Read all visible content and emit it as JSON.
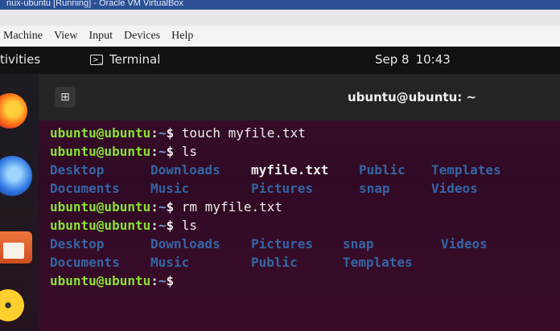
{
  "vbox": {
    "title": "nux-ubuntu [Running] - Oracle VM VirtualBox",
    "menu": [
      "Machine",
      "View",
      "Input",
      "Devices",
      "Help"
    ]
  },
  "topbar": {
    "activities": "tivities",
    "app_label": "Terminal",
    "date": "Sep 8",
    "time": "10:43"
  },
  "terminal": {
    "title": "ubuntu@ubuntu: ~",
    "new_tab_icon": "new-tab-icon",
    "prompt": {
      "user": "ubuntu@ubuntu",
      "colon": ":",
      "path": "~",
      "dollar": "$"
    },
    "commands": [
      "touch myfile.txt",
      "ls",
      "rm myfile.txt",
      "ls"
    ],
    "ls1": {
      "row1": [
        "Desktop",
        "Downloads",
        "myfile.txt",
        "Public",
        "Templates"
      ],
      "row2": [
        "Documents",
        "Music",
        "Pictures",
        "snap",
        "Videos"
      ]
    },
    "ls2": {
      "row1": [
        "Desktop",
        "Downloads",
        "Pictures",
        "snap",
        "Videos"
      ],
      "row2": [
        "Documents",
        "Music",
        "Public",
        "Templates"
      ]
    }
  },
  "dock": [
    "firefox-icon",
    "thunderbird-icon",
    "files-icon",
    "rhythmbox-icon"
  ],
  "colors": {
    "terminal_bg": "#300a24",
    "prompt_user": "#8ae234",
    "prompt_path": "#729fcf",
    "directory": "#3465a4"
  }
}
